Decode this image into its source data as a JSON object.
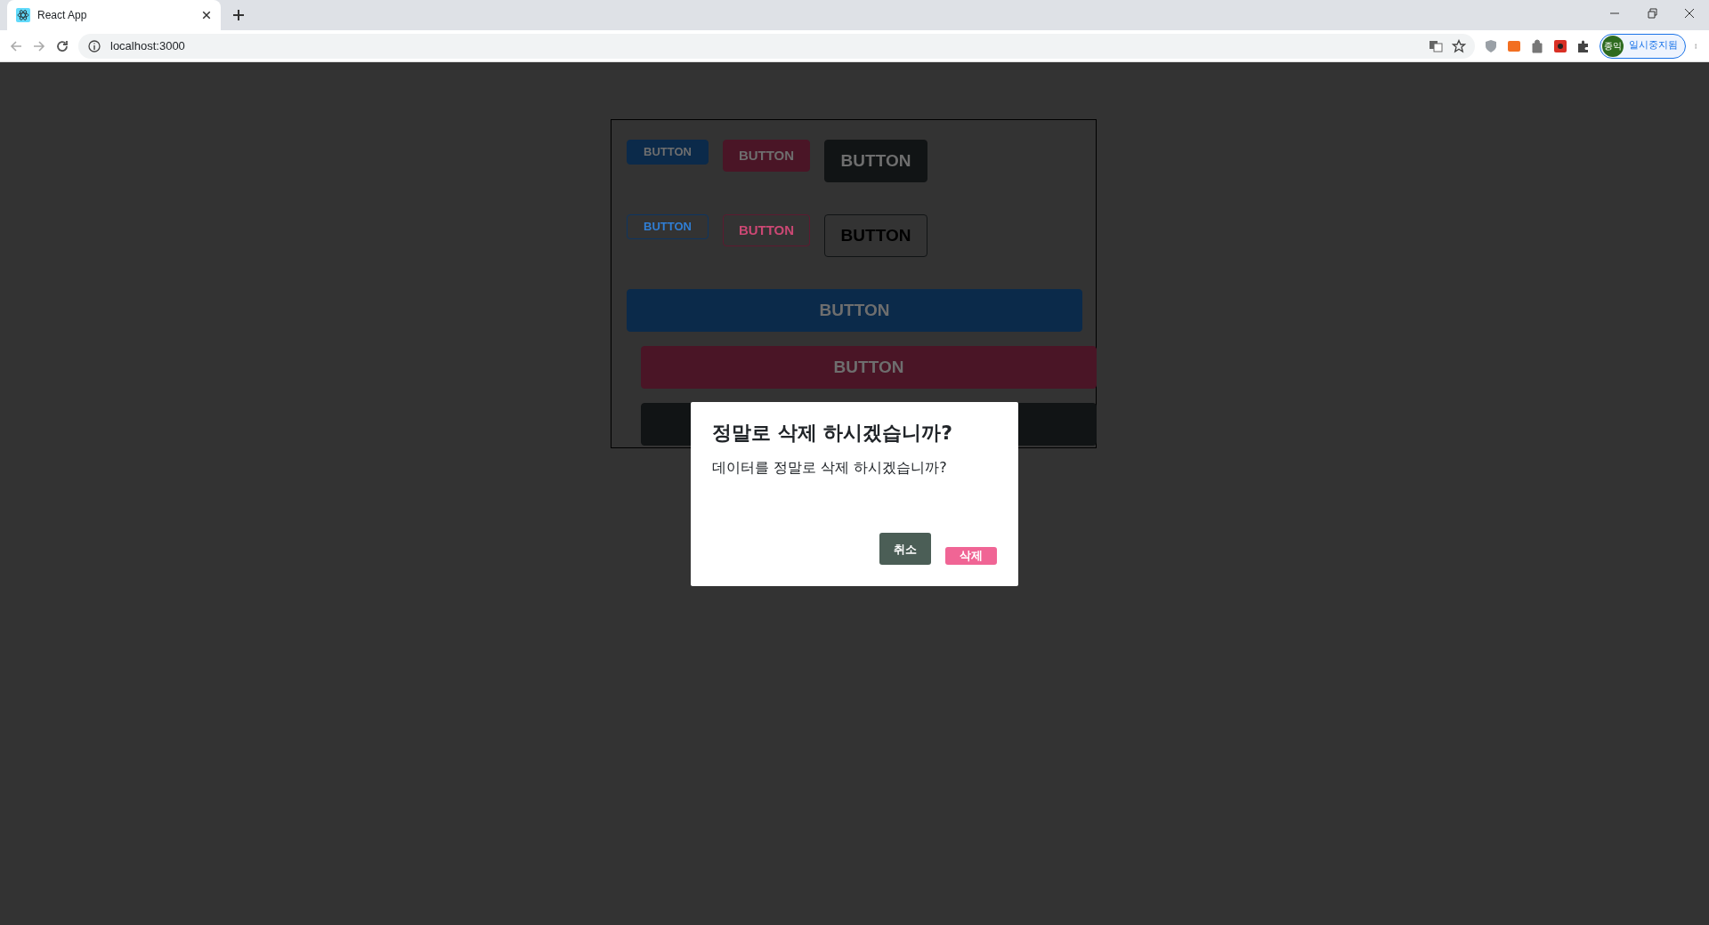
{
  "browser": {
    "tab": {
      "title": "React App"
    },
    "address": "localhost:3000",
    "profile": {
      "initials": "종익",
      "status": "일시중지됨"
    }
  },
  "buttons": [
    {
      "label": "BUTTON",
      "color": "#0b2a4a",
      "kind": "small",
      "outline": false
    },
    {
      "label": "BUTTON",
      "color": "#4a1526",
      "kind": "medium",
      "outline": false
    },
    {
      "label": "BUTTON",
      "color": "#111415",
      "kind": "large",
      "outline": false
    },
    {
      "label": "BUTTON",
      "color": "#0e3560",
      "kind": "small",
      "outline": true
    },
    {
      "label": "BUTTON",
      "color": "#5c1a30",
      "kind": "medium",
      "outline": true
    },
    {
      "label": "BUTTON",
      "color": "#111415",
      "kind": "large",
      "outline": true
    },
    {
      "label": "BUTTON",
      "color": "#0b2a4a",
      "kind": "wide",
      "outline": false
    },
    {
      "label": "BUTTON",
      "color": "#4a1526",
      "kind": "wide",
      "outline": false
    },
    {
      "color": "#111415",
      "kind": "wide",
      "outline": false
    }
  ],
  "dialog": {
    "title": "정말로 삭제 하시겠습니까?",
    "message": "데이터를 정말로 삭제 하시겠습니까?",
    "buttons": [
      {
        "label": "취소",
        "color": "#4b5e56",
        "kind": "cancel"
      },
      {
        "label": "삭제",
        "color": "#f06595",
        "kind": "confirm"
      }
    ]
  }
}
